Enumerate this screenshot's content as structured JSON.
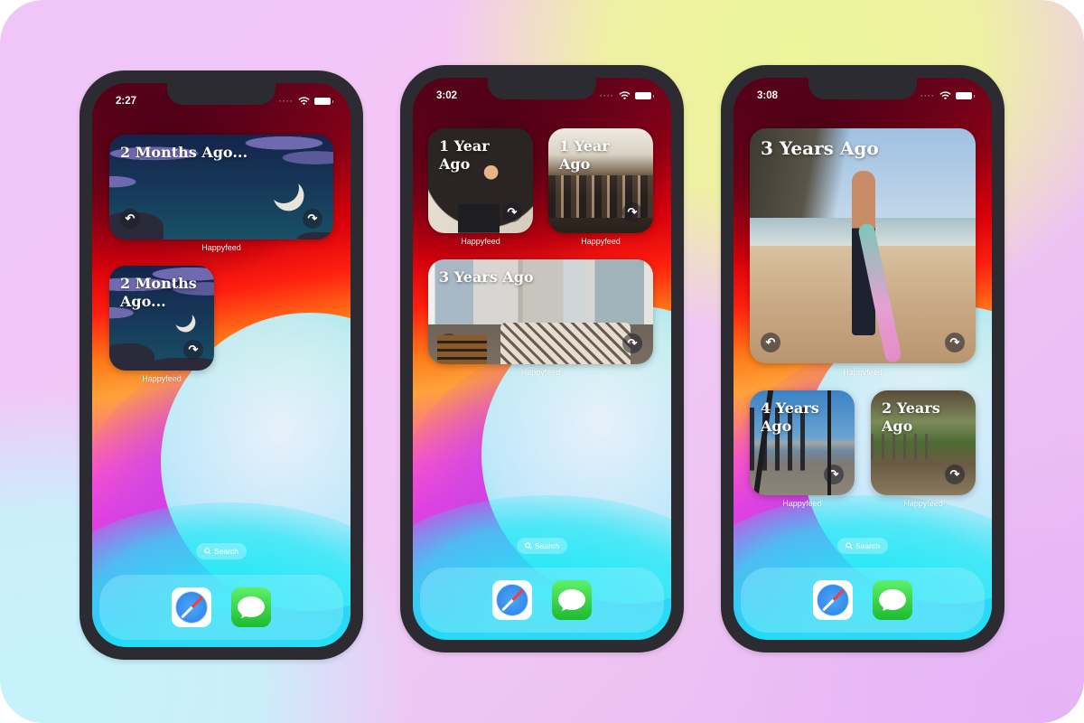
{
  "phones": [
    {
      "time": "2:27",
      "widgets": [
        {
          "title": "2 Months Ago...",
          "label": "Happyfeed",
          "scene": "night-sky",
          "back_icon": "↶",
          "forward_icon": "↷"
        },
        {
          "title": "2 Months Ago...",
          "label": "Happyfeed",
          "scene": "night-sky",
          "forward_icon": "↷"
        }
      ],
      "search_label": "Search",
      "dock_apps": [
        "Safari",
        "Messages"
      ]
    },
    {
      "time": "3:02",
      "widgets": [
        {
          "title": "1 Year Ago",
          "label": "Happyfeed",
          "scene": "man-in-suit",
          "forward_icon": "↷"
        },
        {
          "title": "1 Year Ago",
          "label": "Happyfeed",
          "scene": "restaurant-dinner",
          "forward_icon": "↷"
        },
        {
          "title": "3 Years Ago",
          "label": "Happyfeed",
          "scene": "bedroom",
          "back_icon": "↶",
          "forward_icon": "↷"
        }
      ],
      "search_label": "Search",
      "dock_apps": [
        "Safari",
        "Messages"
      ]
    },
    {
      "time": "3:08",
      "widgets": [
        {
          "title": "3 Years Ago",
          "label": "Happyfeed",
          "scene": "beach-surfer",
          "back_icon": "↶",
          "forward_icon": "↷"
        },
        {
          "title": "4 Years Ago",
          "label": "Happyfeed",
          "scene": "city-skyline",
          "forward_icon": "↷"
        },
        {
          "title": "2 Years Ago",
          "label": "Happyfeed",
          "scene": "garden-pergola",
          "forward_icon": "↷"
        }
      ],
      "search_label": "Search",
      "dock_apps": [
        "Safari",
        "Messages"
      ]
    }
  ],
  "status_icons": [
    "cellular-dots",
    "wifi",
    "battery"
  ],
  "colors": {
    "phone_frame": "#2c2b32",
    "messages_green": "#1dba2f",
    "safari_blue": "#2d7ce8"
  }
}
